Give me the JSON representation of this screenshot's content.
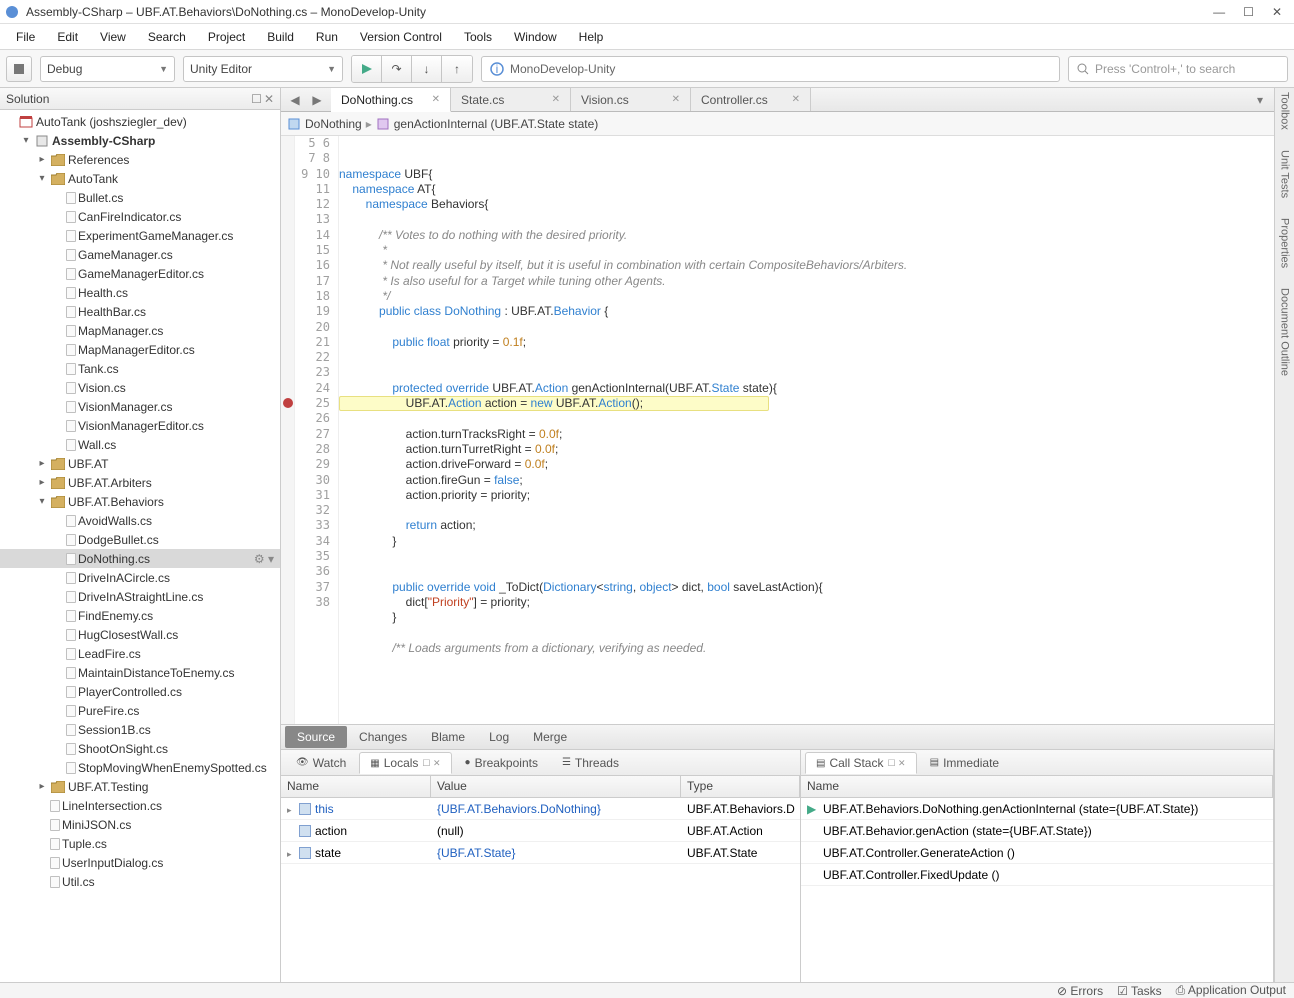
{
  "window": {
    "title": "Assembly-CSharp – UBF.AT.Behaviors\\DoNothing.cs – MonoDevelop-Unity",
    "min": "—",
    "max": "☐",
    "close": "✕"
  },
  "menubar": [
    "File",
    "Edit",
    "View",
    "Search",
    "Project",
    "Build",
    "Run",
    "Version Control",
    "Tools",
    "Window",
    "Help"
  ],
  "toolbar": {
    "config": "Debug",
    "target": "Unity Editor",
    "status": "MonoDevelop-Unity",
    "search_placeholder": "Press 'Control+,' to search"
  },
  "solution": {
    "header": "Solution",
    "root": "AutoTank (joshsziegler_dev)",
    "project": "Assembly-CSharp",
    "folders": [
      {
        "name": "References",
        "indent": 2,
        "exp": "▸",
        "type": "folder"
      },
      {
        "name": "AutoTank",
        "indent": 2,
        "exp": "▾",
        "type": "folder",
        "files": [
          "Bullet.cs",
          "CanFireIndicator.cs",
          "ExperimentGameManager.cs",
          "GameManager.cs",
          "GameManagerEditor.cs",
          "Health.cs",
          "HealthBar.cs",
          "MapManager.cs",
          "MapManagerEditor.cs",
          "Tank.cs",
          "Vision.cs",
          "VisionManager.cs",
          "VisionManagerEditor.cs",
          "Wall.cs"
        ]
      },
      {
        "name": "UBF.AT",
        "indent": 2,
        "exp": "▸",
        "type": "folder"
      },
      {
        "name": "UBF.AT.Arbiters",
        "indent": 2,
        "exp": "▸",
        "type": "folder"
      },
      {
        "name": "UBF.AT.Behaviors",
        "indent": 2,
        "exp": "▾",
        "type": "folder",
        "files": [
          "AvoidWalls.cs",
          "DodgeBullet.cs",
          "DoNothing.cs",
          "DriveInACircle.cs",
          "DriveInAStraightLine.cs",
          "FindEnemy.cs",
          "HugClosestWall.cs",
          "LeadFire.cs",
          "MaintainDistanceToEnemy.cs",
          "PlayerControlled.cs",
          "PureFire.cs",
          "Session1B.cs",
          "ShootOnSight.cs",
          "StopMovingWhenEnemySpotted.cs"
        ]
      },
      {
        "name": "UBF.AT.Testing",
        "indent": 2,
        "exp": "▸",
        "type": "folder"
      }
    ],
    "loose_files": [
      "LineIntersection.cs",
      "MiniJSON.cs",
      "Tuple.cs",
      "UserInputDialog.cs",
      "Util.cs"
    ],
    "selected": "DoNothing.cs"
  },
  "editor": {
    "tabs": [
      {
        "label": "DoNothing.cs",
        "active": true
      },
      {
        "label": "State.cs"
      },
      {
        "label": "Vision.cs"
      },
      {
        "label": "Controller.cs"
      }
    ],
    "breadcrumb": {
      "class": "DoNothing",
      "sep": "▸",
      "member": "genActionInternal (UBF.AT.State state)"
    },
    "first_line": 5,
    "breakpoint_line": 22,
    "highlight_line": 22,
    "lines": [
      "",
      "",
      "namespace UBF{",
      "    namespace AT{",
      "        namespace Behaviors{",
      "",
      "            /** Votes to do nothing with the desired priority.",
      "             *",
      "             * Not really useful by itself, but it is useful in combination with certain CompositeBehaviors/Arbiters.",
      "             * Is also useful for a Target while tuning other Agents.",
      "             */",
      "            public class DoNothing : UBF.AT.Behavior {",
      "",
      "                public float priority = 0.1f;",
      "",
      "",
      "                protected override UBF.AT.Action genActionInternal(UBF.AT.State state){",
      "                    UBF.AT.Action action = new UBF.AT.Action();",
      "",
      "                    action.turnTracksRight = 0.0f;",
      "                    action.turnTurretRight = 0.0f;",
      "                    action.driveForward = 0.0f;",
      "                    action.fireGun = false;",
      "                    action.priority = priority;",
      "",
      "                    return action;",
      "                }",
      "",
      "",
      "                public override void _ToDict(Dictionary<string, object> dict, bool saveLastAction){",
      "                    dict[\"Priority\"] = priority;",
      "                }",
      "",
      "                /** Loads arguments from a dictionary, verifying as needed."
    ]
  },
  "bottom_source_tabs": [
    "Source",
    "Changes",
    "Blame",
    "Log",
    "Merge"
  ],
  "debug": {
    "left_tabs": [
      "Watch",
      "Locals",
      "Breakpoints",
      "Threads"
    ],
    "left_active": "Locals",
    "locals_headers": [
      "Name",
      "Value",
      "Type"
    ],
    "locals": [
      {
        "exp": "▸",
        "name": "this",
        "value": "{UBF.AT.Behaviors.DoNothing}",
        "type": "UBF.AT.Behaviors.D"
      },
      {
        "exp": "",
        "name": "action",
        "value": "(null)",
        "type": "UBF.AT.Action"
      },
      {
        "exp": "▸",
        "name": "state",
        "value": "{UBF.AT.State}",
        "type": "UBF.AT.State"
      }
    ],
    "right_tabs": [
      "Call Stack",
      "Immediate"
    ],
    "right_active": "Call Stack",
    "stack_header": "Name",
    "stack": [
      "UBF.AT.Behaviors.DoNothing.genActionInternal (state={UBF.AT.State})",
      "UBF.AT.Behavior.genAction (state={UBF.AT.State})",
      "UBF.AT.Controller.GenerateAction ()",
      "UBF.AT.Controller.FixedUpdate ()"
    ]
  },
  "right_rail": [
    "Toolbox",
    "Unit Tests",
    "Properties",
    "Document Outline"
  ],
  "statusbar": [
    "Errors",
    "Tasks",
    "Application Output"
  ]
}
